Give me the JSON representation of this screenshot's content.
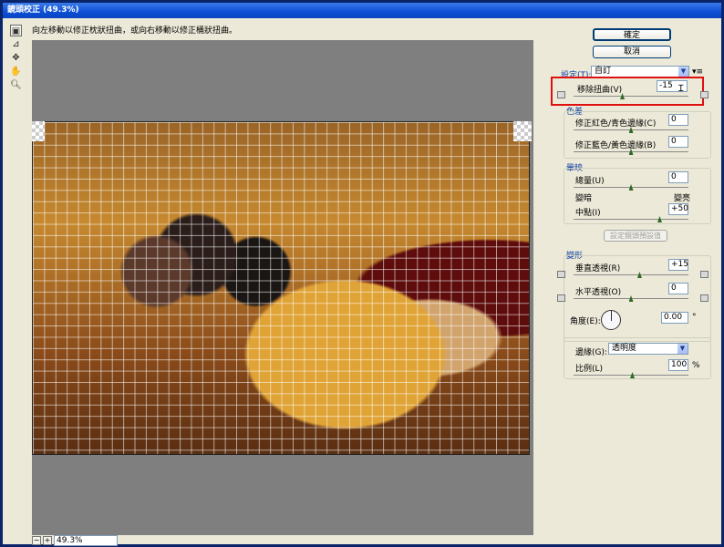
{
  "window": {
    "title": "鏡頭校正 (49.3%)"
  },
  "hint": "向左移動以修正枕狀扭曲，或向右移動以修正桶狀扭曲。",
  "zoom": "49.3%",
  "buttons": {
    "ok": "確定",
    "cancel": "取消",
    "set_default": "設定鏡頭預設值"
  },
  "settings": {
    "label": "設定(T):",
    "value": "自訂",
    "menu_icon": "▾≡"
  },
  "remove_distortion": {
    "label": "移除扭曲(V)",
    "value": "-15",
    "slider": -0.15
  },
  "chromatic": {
    "heading": "色差",
    "red_cyan": {
      "label": "修正紅色/青色邊緣(C)",
      "value": "0",
      "slider": 0
    },
    "blue_yellow": {
      "label": "修正藍色/黃色邊緣(B)",
      "value": "0",
      "slider": 0
    }
  },
  "vignette": {
    "heading": "暈映",
    "amount": {
      "label": "總量(U)",
      "value": "0",
      "slider": 0
    },
    "darken": "變暗",
    "lighten": "變亮",
    "midpoint": {
      "label": "中點(I)",
      "value": "+50",
      "slider": 0.5
    }
  },
  "transform": {
    "heading": "變形",
    "vertical": {
      "label": "垂直透視(R)",
      "value": "+15",
      "slider": 0.15
    },
    "horizontal": {
      "label": "水平透視(O)",
      "value": "0",
      "slider": 0
    },
    "angle": {
      "label": "角度(E):",
      "value": "0.00",
      "unit": "°"
    },
    "edge": {
      "label": "邊緣(G):",
      "value": "透明度"
    },
    "scale": {
      "label": "比例(L)",
      "value": "100",
      "unit": "%"
    }
  }
}
